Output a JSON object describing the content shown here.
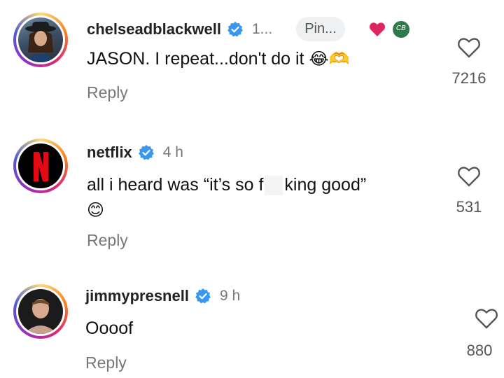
{
  "comments": [
    {
      "username": "chelseadblackwell",
      "time": "1...",
      "pin_label": "Pin...",
      "text": "JASON. I repeat...don't do it",
      "emoji": "😂🫶",
      "reply_label": "Reply",
      "like_count": "7216"
    },
    {
      "username": "netflix",
      "time": "4 h",
      "text_before": "all i heard was “it’s so f",
      "text_after": "king good”",
      "emoji": "😊",
      "reply_label": "Reply",
      "like_count": "531"
    },
    {
      "username": "jimmypresnell",
      "time": "9 h",
      "text": "Oooof",
      "reply_label": "Reply",
      "like_count": "880"
    }
  ],
  "colors": {
    "verified": "#3897f0",
    "netflix_red": "#e50914",
    "liked_heart": "#e0245e"
  },
  "icons": [
    "verified-badge-icon",
    "heart-icon",
    "red-heart-icon",
    "creator-badge-icon"
  ]
}
